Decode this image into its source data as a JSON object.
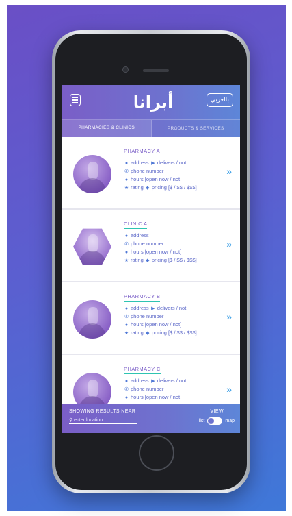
{
  "app": {
    "logo_text": "أبرانا",
    "language_button": "بالعربي"
  },
  "tabs": [
    {
      "label": "PHARMACIES & CLINICS",
      "active": true
    },
    {
      "label": "PRODUCTS & SERVICES",
      "active": false
    }
  ],
  "listings": [
    {
      "name": "PHARMACY A",
      "address": "address",
      "delivers": "delivers / not",
      "phone": "phone number",
      "hours": "hours [open now / not]",
      "rating": "rating",
      "pricing": "pricing [$ / $$ / $$$]"
    },
    {
      "name": "CLINIC A",
      "address": "address",
      "phone": "phone number",
      "hours": "hours [open now / not]",
      "rating": "rating",
      "pricing": "pricing [$ / $$ / $$$]"
    },
    {
      "name": "PHARMACY B",
      "address": "address",
      "delivers": "delivers / not",
      "phone": "phone number",
      "hours": "hours [open now / not]",
      "rating": "rating",
      "pricing": "pricing [$ / $$ / $$$]"
    },
    {
      "name": "PHARMACY C",
      "address": "address",
      "delivers": "delivers / not",
      "phone": "phone number",
      "hours": "hours [open now / not]"
    }
  ],
  "bottom_bar": {
    "showing_label": "SHOWING RESULTS NEAR",
    "location_placeholder": "enter location",
    "view_label": "VIEW",
    "list_label": "list",
    "map_label": "map"
  },
  "icons": {
    "menu": "menu-icon",
    "location": "location-pin-icon",
    "delivery": "delivery-icon",
    "phone": "phone-icon",
    "hours": "clock-icon",
    "rating": "star-icon",
    "pricing": "tag-icon",
    "chevron": "chevron-right-icon",
    "search": "search-icon"
  },
  "colors": {
    "primary_purple": "#7a5ec7",
    "primary_blue": "#5d86d8",
    "accent_teal": "#2fc4b2",
    "text_blue": "#5b67c8",
    "chevron_blue": "#4aa6e8"
  }
}
